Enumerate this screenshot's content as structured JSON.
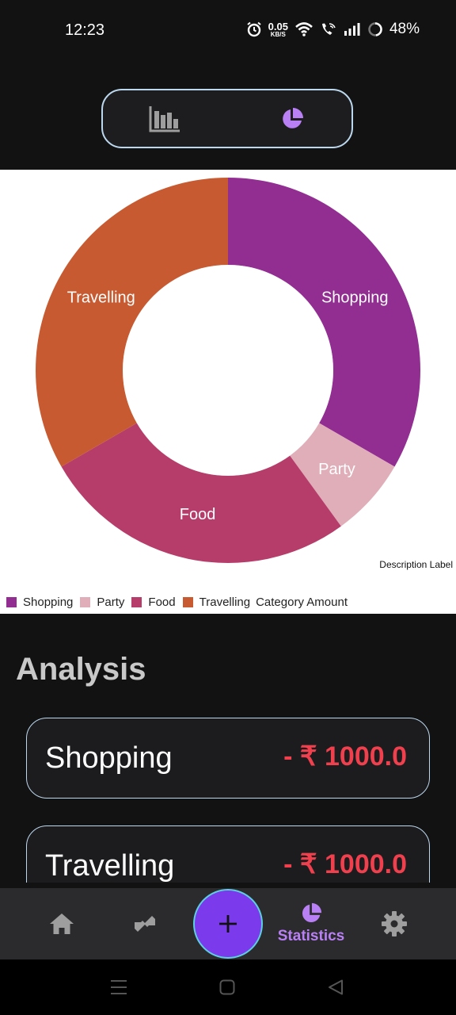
{
  "status": {
    "time": "12:23",
    "speed_value": "0.05",
    "speed_unit": "KB/S",
    "battery": "48%"
  },
  "toggle": {
    "left_icon": "bar-chart-icon",
    "right_icon": "pie-chart-icon",
    "active": "pie"
  },
  "chart_data": {
    "type": "pie",
    "categories": [
      "Shopping",
      "Party",
      "Food",
      "Travelling"
    ],
    "values": [
      1000,
      200,
      800,
      1000
    ],
    "colors": [
      "#922d92",
      "#e0aeb8",
      "#b63d6a",
      "#c75a30"
    ],
    "legend_title": "Category Amount",
    "description_label": "Description Label",
    "legend_position": "bottom-left"
  },
  "analysis": {
    "title": "Analysis",
    "items": [
      {
        "name": "Shopping",
        "amount": "- ₹ 1000.0"
      },
      {
        "name": "Travelling",
        "amount": "- ₹ 1000.0"
      }
    ]
  },
  "nav": {
    "items": [
      {
        "icon": "home-icon"
      },
      {
        "icon": "transfer-icon"
      },
      {
        "icon": "add-icon"
      },
      {
        "icon": "pie-chart-icon",
        "label": "Statistics"
      },
      {
        "icon": "gear-icon"
      }
    ],
    "accent": "#b980f5",
    "fab_color": "#7c3aed"
  }
}
